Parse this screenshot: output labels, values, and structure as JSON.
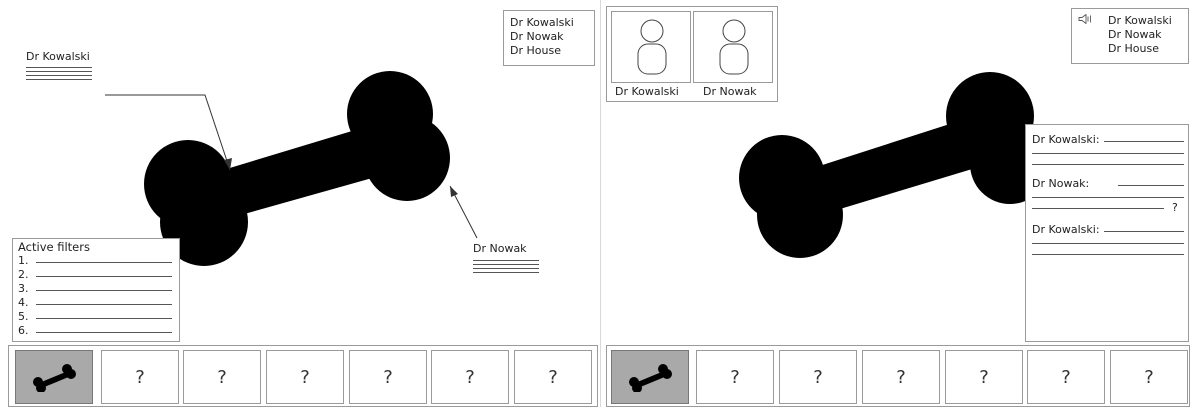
{
  "left_panel": {
    "annotation_top": {
      "name": "Dr Kowalski"
    },
    "annotation_right": {
      "name": "Dr Nowak"
    },
    "viewers_box": {
      "names": [
        "Dr Kowalski",
        "Dr Nowak",
        "Dr House"
      ]
    },
    "filters": {
      "title": "Active filters",
      "items": [
        "1.",
        "2.",
        "3.",
        "4.",
        "5.",
        "6."
      ]
    },
    "thumbnails": [
      "?",
      "?",
      "?",
      "?",
      "?",
      "?"
    ]
  },
  "right_panel": {
    "video_call": {
      "participants": [
        "Dr Kowalski",
        "Dr Nowak"
      ]
    },
    "audio_list": {
      "icon": "speaker-icon",
      "names": [
        "Dr Kowalski",
        "Dr Nowak",
        "Dr House"
      ]
    },
    "chat": {
      "messages": [
        {
          "author": "Dr Kowalski:"
        },
        {
          "author": "Dr Nowak:",
          "trailing": "?"
        },
        {
          "author": "Dr Kowalski:"
        }
      ]
    },
    "thumbnails": [
      "?",
      "?",
      "?",
      "?",
      "?",
      "?"
    ]
  }
}
